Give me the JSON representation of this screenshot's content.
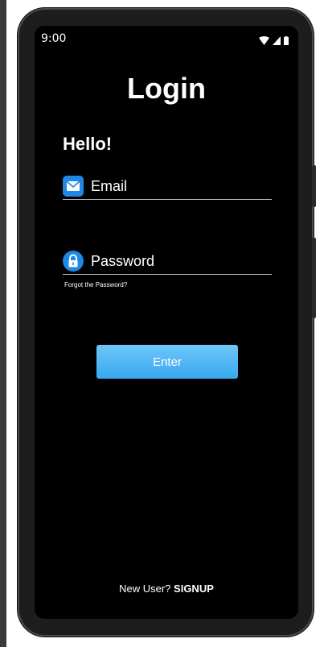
{
  "status_bar": {
    "time": "9:00",
    "icons": [
      "wifi-icon",
      "signal-icon",
      "battery-icon"
    ]
  },
  "screen": {
    "title": "Login",
    "greeting": "Hello!",
    "email": {
      "label": "Email",
      "icon": "mail-icon",
      "icon_color": "#1e88e5"
    },
    "password": {
      "label": "Password",
      "icon": "lock-icon",
      "icon_color": "#1e88e5"
    },
    "forgot_label": "Forgot the Password?",
    "enter_label": "Enter",
    "enter_color": "#4fb3f2",
    "signup_prompt": "New User?",
    "signup_label": "SIGNUP"
  }
}
